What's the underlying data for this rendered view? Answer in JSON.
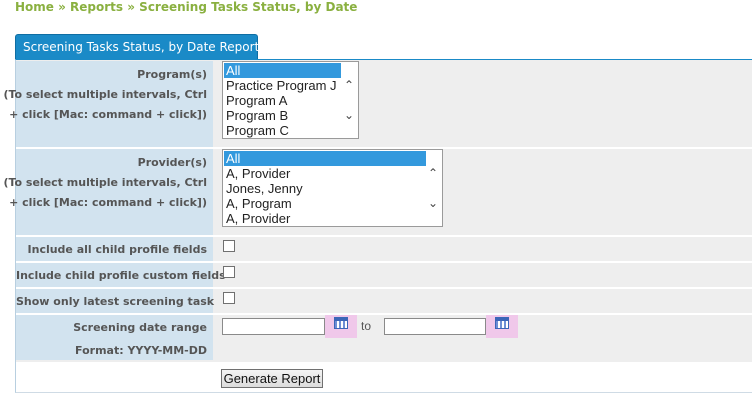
{
  "breadcrumb": {
    "home": "Home",
    "sep1": " » ",
    "reports": "Reports",
    "sep2": " » ",
    "current": "Screening Tasks Status, by Date"
  },
  "tab": {
    "label": "Screening Tasks Status, by Date Report"
  },
  "form": {
    "programs": {
      "label": "Program(s)",
      "hint1": "(To select multiple intervals, Ctrl",
      "hint2": "+ click [Mac: command + click])",
      "options": [
        "All",
        "Practice Program J",
        "Program A",
        "Program B",
        "Program C"
      ],
      "selected": "All"
    },
    "providers": {
      "label": "Provider(s)",
      "hint1": "(To select multiple intervals, Ctrl",
      "hint2": "+ click [Mac: command + click])",
      "options": [
        "All",
        "A, Provider",
        "Jones, Jenny",
        "A, Program",
        "A, Provider"
      ],
      "selected": "All"
    },
    "include_child_profile_fields": {
      "label": "Include all child profile fields",
      "checked": false
    },
    "include_child_custom_fields": {
      "label": "Include child profile custom fields",
      "checked": false
    },
    "show_latest_task": {
      "label": "Show only latest screening task",
      "checked": false
    },
    "date_range": {
      "label": "Screening date range",
      "format": "Format: YYYY-MM-DD",
      "from_value": "",
      "to_label": "to",
      "to_value": ""
    },
    "generate_label": "Generate Report"
  },
  "colors": {
    "breadcrumb": "#8ab040",
    "tab": "#1a8ac7",
    "label_bg": "#d2e3ef",
    "row_bg": "#eeeeee",
    "selection": "#3399dd",
    "calendar_bg": "#f0c8ea"
  }
}
